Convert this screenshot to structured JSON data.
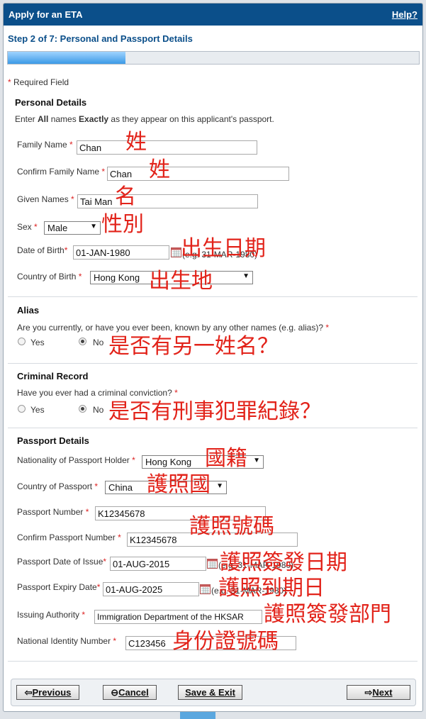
{
  "header": {
    "title": "Apply for an ETA",
    "help": "Help?"
  },
  "step": "Step 2 of 7: Personal and Passport Details",
  "progress_fraction": 0.2857,
  "required_note": "Required Field",
  "personal": {
    "heading": "Personal Details",
    "instruction": {
      "enter": "Enter ",
      "all": "All",
      "names": " names ",
      "exactly": "Exactly",
      "rest": " as they appear on this applicant's passport."
    },
    "family_name": {
      "label": "Family Name",
      "value": "Chan",
      "annotation": "姓"
    },
    "confirm_family_name": {
      "label": "Confirm Family Name",
      "value": "Chan",
      "annotation": "姓"
    },
    "given_names": {
      "label": "Given Names",
      "value": "Tai Man",
      "annotation": "名"
    },
    "sex": {
      "label": "Sex",
      "value": "Male",
      "annotation": "性別"
    },
    "dob": {
      "label": "Date of Birth",
      "value": "01-JAN-1980",
      "hint": "(e.g. 31-MAR-1980)",
      "annotation": "出生日期"
    },
    "country_of_birth": {
      "label": "Country of Birth",
      "value": "Hong Kong",
      "annotation": "出生地"
    }
  },
  "alias": {
    "heading": "Alias",
    "question": "Are you currently, or have you ever been, known by any other names (e.g. alias)?",
    "yes": "Yes",
    "no": "No",
    "selected": "No",
    "annotation": "是否有另一姓名？"
  },
  "criminal": {
    "heading": "Criminal Record",
    "question": "Have you ever had a criminal conviction?",
    "yes": "Yes",
    "no": "No",
    "selected": "No",
    "annotation": "是否有刑事犯罪紀錄？"
  },
  "passport": {
    "heading": "Passport Details",
    "nationality": {
      "label": "Nationality of Passport Holder",
      "value": "Hong Kong",
      "annotation": "國籍"
    },
    "country": {
      "label": "Country of Passport",
      "value": "China",
      "annotation": "護照國"
    },
    "number": {
      "label": "Passport Number",
      "value": "K12345678"
    },
    "confirm_number": {
      "label": "Confirm Passport Number",
      "value": "K12345678",
      "annotation": "護照號碼"
    },
    "issue_date": {
      "label": "Passport Date of Issue",
      "value": "01-AUG-2015",
      "hint": "(e.g. 31-MAR-1980)",
      "annotation": "護照簽發日期"
    },
    "expiry_date": {
      "label": "Passport Expiry Date",
      "value": "01-AUG-2025",
      "hint": "(e.g. 31-MAR-1980)",
      "annotation": "護照到期日"
    },
    "authority": {
      "label": "Issuing Authority",
      "value": "Immigration Department of the HKSAR",
      "annotation": "護照簽發部門"
    },
    "national_id": {
      "label": "National Identity Number",
      "value": "C123456",
      "annotation": "身份證號碼"
    }
  },
  "buttons": {
    "previous": "Previous",
    "cancel": "Cancel",
    "save_exit": "Save & Exit",
    "next": "Next"
  },
  "colors": {
    "header": "#0b4f8a",
    "annotation": "#e2231a",
    "required_star": "#d22222"
  }
}
